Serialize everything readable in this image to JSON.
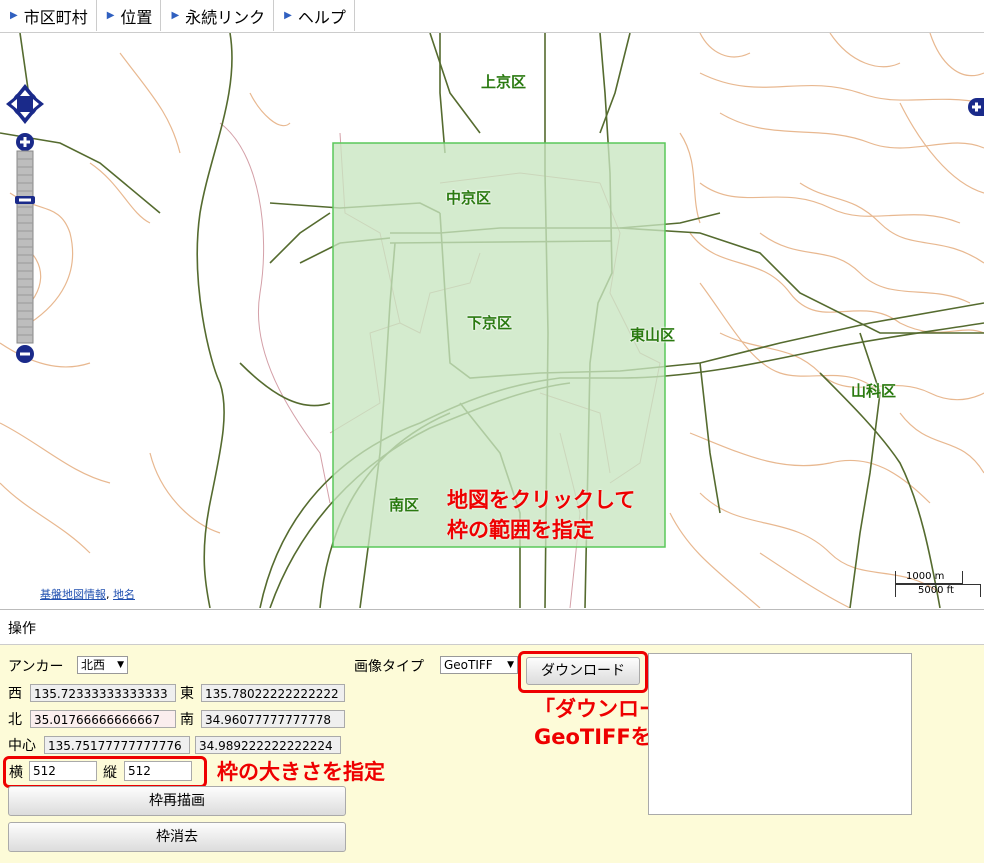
{
  "menu": {
    "items": [
      {
        "label": "市区町村"
      },
      {
        "label": "位置"
      },
      {
        "label": "永続リンク"
      },
      {
        "label": "ヘルプ"
      }
    ]
  },
  "map": {
    "wards": {
      "kamigyo": "上京区",
      "nakagyo": "中京区",
      "shimogyo": "下京区",
      "higashiyama": "東山区",
      "yamashina": "山科区",
      "minami": "南区"
    },
    "note_lines": [
      "地図をクリックして",
      "枠の範囲を指定"
    ],
    "attribution": {
      "link1": "基盤地図情報",
      "sep": ", ",
      "link2": "地名"
    },
    "scale": {
      "metric": "1000 m",
      "imperial": "5000 ft"
    },
    "colors": {
      "selection_fill": "#c8e6c0",
      "selection_border": "#5ac85a",
      "road": "#556b2f",
      "contour": "#e8b890",
      "boundary": "#d4a0a8"
    }
  },
  "panel": {
    "title": "操作",
    "anchor_label": "アンカー",
    "anchor_value": "北西",
    "image_type_label": "画像タイプ",
    "image_type_value": "GeoTIFF",
    "download_button": "ダウンロード",
    "west_label": "西",
    "west_value": "135.72333333333333",
    "east_label": "東",
    "east_value": "135.78022222222222",
    "north_label": "北",
    "north_value": "35.01766666666667",
    "south_label": "南",
    "south_value": "34.96077777777778",
    "center_label": "中心",
    "center_lon": "135.75177777777776",
    "center_lat": "34.989222222222224",
    "width_label": "横",
    "width_value": "512",
    "height_label": "縦",
    "height_value": "512",
    "redraw_button": "枠再描画",
    "clear_button": "枠消去",
    "annotation_size": "枠の大きさを指定",
    "annotation_download": [
      "「ダウンロード」ボタンで",
      "GeoTIFFをダウンロード"
    ]
  }
}
